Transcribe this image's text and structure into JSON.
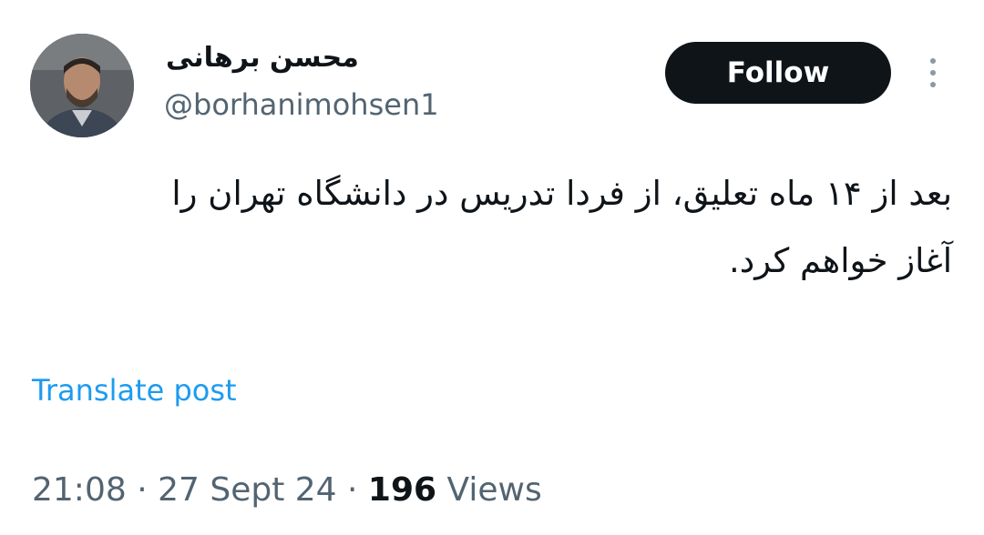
{
  "author": {
    "display_name": "محسن برهانی",
    "handle": "@borhanimohsen1"
  },
  "actions": {
    "follow_label": "Follow"
  },
  "post": {
    "text": "بعد از ۱۴ ماه تعلیق، از فردا تدریس در دانشگاه تهران را\nآغاز خواهم کرد.",
    "translate_label": "Translate post"
  },
  "meta": {
    "time": "21:08",
    "separator": " · ",
    "date": "27 Sept 24",
    "views_count": "196",
    "views_label": " Views"
  },
  "colors": {
    "text": "#0f1419",
    "secondary": "#536471",
    "link": "#1d9bf0",
    "follow_bg": "#0f1419"
  },
  "icons": {
    "more": "more-vertical-icon"
  }
}
